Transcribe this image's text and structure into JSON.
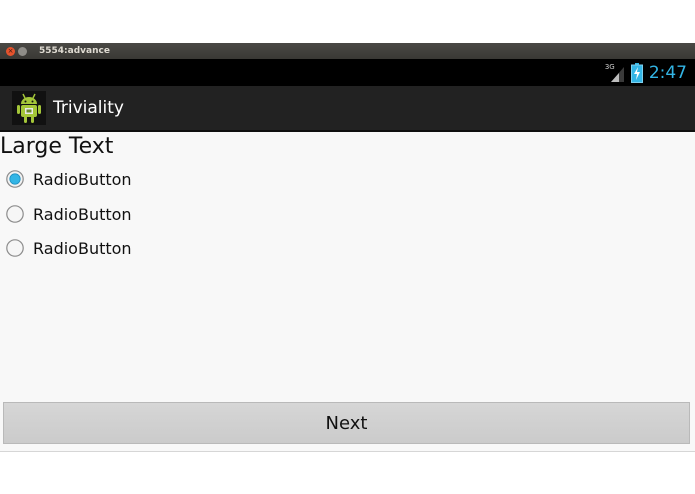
{
  "window": {
    "title": "5554:advance",
    "close_glyph": "×",
    "minimize_glyph": "–"
  },
  "statusbar": {
    "network_label": "3G",
    "time": "2:47",
    "icons": [
      "signal-icon",
      "battery-icon"
    ],
    "clock_color": "#33b5e5"
  },
  "actionbar": {
    "title": "Triviality",
    "icon": "android-app-icon"
  },
  "content": {
    "heading": "Large Text",
    "radio_options": [
      {
        "label": "RadioButton",
        "checked": true
      },
      {
        "label": "RadioButton",
        "checked": false
      },
      {
        "label": "RadioButton",
        "checked": false
      }
    ],
    "next_label": "Next"
  },
  "colors": {
    "accent": "#33b5e5",
    "actionbar_bg": "#222222",
    "button_bg": "#d0d0d0"
  }
}
